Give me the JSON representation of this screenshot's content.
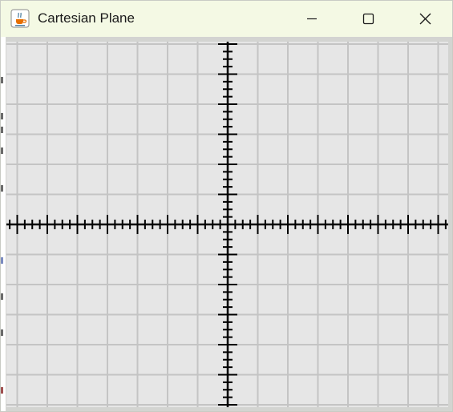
{
  "window": {
    "title": "Cartesian Plane",
    "app_icon": "java-coffee-cup-icon",
    "controls": {
      "minimize_icon": "minimize-icon",
      "maximize_icon": "maximize-icon",
      "close_icon": "close-icon"
    }
  },
  "plane": {
    "background_color": "#e6e6e6",
    "grid_color": "#c4c4c4",
    "axis_color": "#000000",
    "x_range": [
      -7,
      7
    ],
    "y_range": [
      -6,
      6
    ],
    "major_step": 1,
    "minor_divisions": 4,
    "grid": true
  }
}
